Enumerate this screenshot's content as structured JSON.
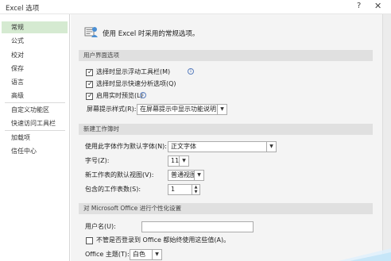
{
  "window": {
    "title": "Excel 选项",
    "help_glyph": "?",
    "close_glyph": "✕"
  },
  "sidebar": {
    "items": [
      {
        "label": "常规",
        "selected": true
      },
      {
        "label": "公式"
      },
      {
        "label": "校对"
      },
      {
        "label": "保存"
      },
      {
        "label": "语言"
      },
      {
        "label": "高级"
      },
      {
        "label": "自定义功能区"
      },
      {
        "label": "快速访问工具栏"
      },
      {
        "label": "加载项"
      },
      {
        "label": "信任中心"
      }
    ]
  },
  "header": {
    "text": "使用 Excel 时采用的常规选项。",
    "icon": "general-options-icon"
  },
  "sections": {
    "ui": "用户界面选项",
    "new_workbook": "新建工作簿时",
    "personalize": "对 Microsoft Office 进行个性化设置"
  },
  "ui_options": {
    "mini_toolbar": {
      "label": "选择时显示浮动工具栏(M)",
      "checked": true
    },
    "quick_analysis": {
      "label": "选择时显示快速分析选项(Q)",
      "checked": true
    },
    "live_preview": {
      "label": "启用实时预览(L)",
      "checked": true
    },
    "screentip_label": "屏幕提示样式(R):",
    "screentip_value": "在屏幕提示中显示功能说明"
  },
  "new_workbook": {
    "font_label": "使用此字体作为默认字体(N):",
    "font_value": "正文字体",
    "size_label": "字号(Z):",
    "size_value": "11",
    "view_label": "新工作表的默认视图(V):",
    "view_value": "普通视图",
    "sheets_label": "包含的工作表数(S):",
    "sheets_value": "1"
  },
  "personalize": {
    "username_label": "用户名(U):",
    "username_value": "",
    "always_use": {
      "label": "不管是否登录到 Office 都始终使用这些值(A)。",
      "checked": false
    },
    "theme_label": "Office 主题(T):",
    "theme_value": "白色"
  },
  "glyphs": {
    "check": "✓",
    "dropdown": "▼",
    "spin_up": "▲",
    "spin_down": "▼",
    "info": "i"
  },
  "colors": {
    "selected_nav": "#d5ead1",
    "section_bg": "#e0e0e0",
    "content_bg": "#f4f4f4"
  }
}
